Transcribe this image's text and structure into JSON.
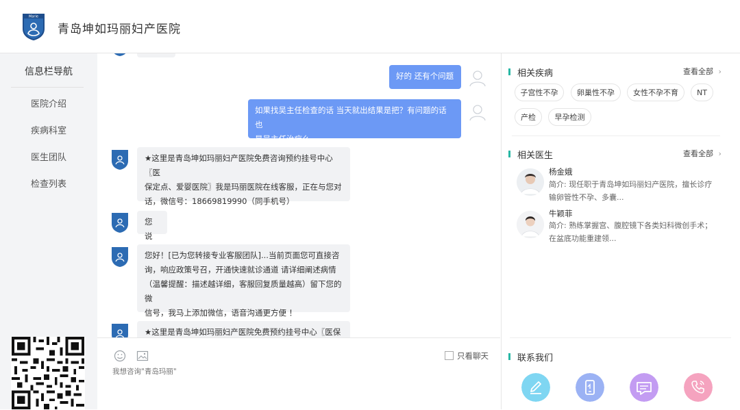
{
  "header": {
    "hospital_name": "青岛坤如玛丽妇产医院",
    "logo_text": "Marie"
  },
  "left_nav": {
    "title": "信息栏导航",
    "items": [
      "医院介绍",
      "疾病科室",
      "医生团队",
      "检查列表"
    ]
  },
  "chat": {
    "messages": [
      {
        "from": "user",
        "text": "好的 还有个问题"
      },
      {
        "from": "user",
        "lines": [
          "如果找吴主任检查的话 当天就出结果是把？有问题的话也",
          "是吴主任治疗么"
        ]
      },
      {
        "from": "bot",
        "lines": [
          "★这里是青岛坤如玛丽妇产医院免费咨询预约挂号中心〖医",
          "保定点、爱婴医院〗我是玛丽医院在线客服，正在与您对",
          "话，微信号：18669819990（同手机号）"
        ]
      },
      {
        "from": "bot",
        "text": "您说"
      },
      {
        "from": "bot",
        "lines": [
          "您好！[已为您转接专业客服团队]...当前页面您可直接咨",
          "询，响应政策号召，开通快速就诊通道 请详细阐述病情",
          "（温馨提醒：描述越详细，客服回复质量越高）留下您的微",
          "信号，我马上添加微信，语音沟通更方便 ！"
        ]
      },
      {
        "from": "bot",
        "lines": [
          "★这里是青岛坤如玛丽妇产医院免费预约挂号中心〖医保定"
        ]
      }
    ]
  },
  "input": {
    "placeholder": "我想咨询\"青岛玛丽\"",
    "only_chat_label": "只看聊天",
    "only_chat_checked": false
  },
  "related_diseases": {
    "title": "相关疾病",
    "view_all": "查看全部",
    "tags": [
      "子宫性不孕",
      "卵巢性不孕",
      "女性不孕不育",
      "NT",
      "产检",
      "早孕检测"
    ]
  },
  "related_doctors": {
    "title": "相关医生",
    "view_all": "查看全部",
    "doctors": [
      {
        "name": "杨金娥",
        "desc_line1": "简介: 现任职于青岛坤如玛丽妇产医院，擅长诊疗",
        "desc_line2": "输卵管性不孕、多囊..."
      },
      {
        "name": "牛颖菲",
        "desc_line1": "简介: 熟练掌握宫、腹腔镜下各类妇科微创手术；",
        "desc_line2": "在盆底功能重建领..."
      }
    ]
  },
  "contact": {
    "title": "联系我们",
    "buttons": [
      {
        "icon": "edit-icon",
        "color": "#7fd6f2"
      },
      {
        "icon": "phone-screen-icon",
        "color": "#9bb2f4"
      },
      {
        "icon": "message-icon",
        "color": "#c39cf2"
      },
      {
        "icon": "phone-call-icon",
        "color": "#f5a3bf"
      }
    ]
  },
  "colors": {
    "user_bubble": "#6c99f5",
    "bot_bubble": "#f1f2f4",
    "accent": "#27b7a4"
  }
}
